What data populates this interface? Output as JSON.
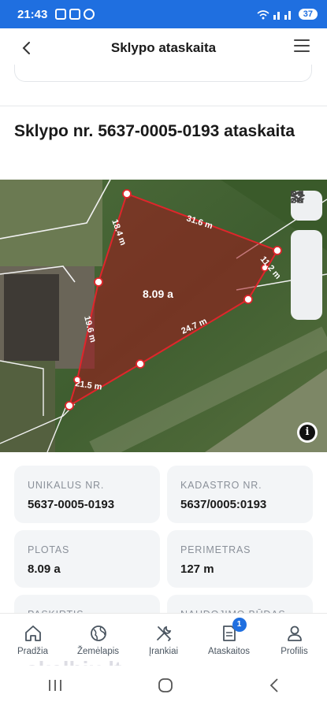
{
  "status": {
    "time": "21:43",
    "battery": "37"
  },
  "header": {
    "title": "Sklypo ataskaita"
  },
  "page": {
    "heading": "Sklypo nr. 5637-0005-0193 ataskaita"
  },
  "map": {
    "area_label": "8.09 a",
    "edge_labels": [
      "31.6 m",
      "11.2 m",
      "24.7 m",
      "21.5 m",
      "19.6 m",
      "18.4 m"
    ]
  },
  "details": [
    {
      "label": "UNIKALUS NR.",
      "value": "5637-0005-0193"
    },
    {
      "label": "KADASTRO NR.",
      "value": "5637/0005:0193"
    },
    {
      "label": "PLOTAS",
      "value": "8.09 a"
    },
    {
      "label": "PERIMETRAS",
      "value": "127 m"
    },
    {
      "label": "PASKIRTIS",
      "value": ""
    },
    {
      "label": "NAUDOJIMO BŪDAS",
      "value": ""
    }
  ],
  "nav": {
    "items": [
      {
        "label": "Pradžia",
        "icon": "home-icon"
      },
      {
        "label": "Žemėlapis",
        "icon": "globe-icon"
      },
      {
        "label": "Įrankiai",
        "icon": "tools-icon"
      },
      {
        "label": "Ataskaitos",
        "icon": "report-icon",
        "badge": "1"
      },
      {
        "label": "Profilis",
        "icon": "user-icon"
      }
    ]
  },
  "watermark": "skelbiu.lt",
  "colors": {
    "accent": "#1f6fe0",
    "parcel_outline": "#e0252b"
  }
}
